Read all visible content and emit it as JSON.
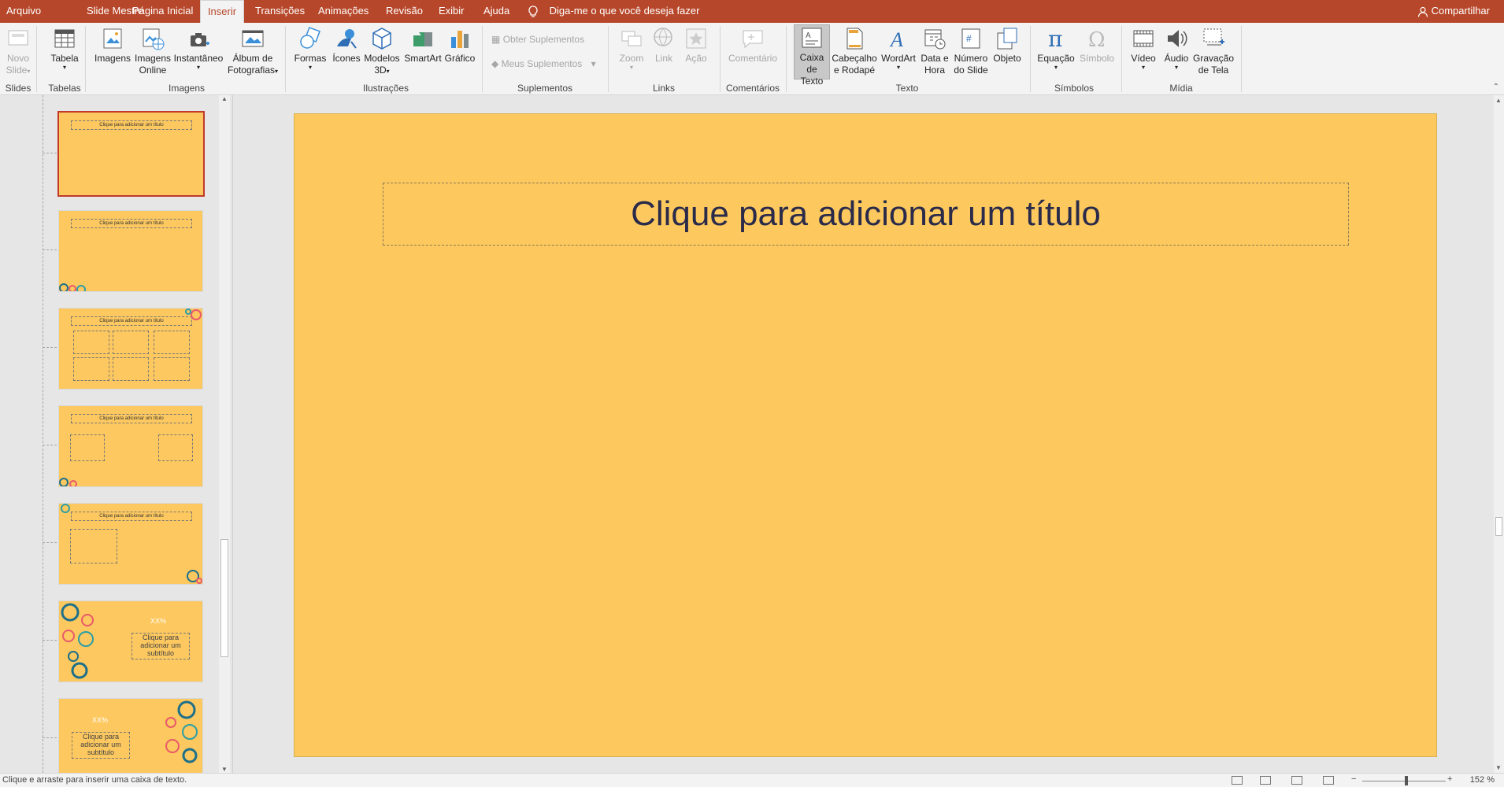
{
  "tabs": [
    "Arquivo",
    "Slide Mestre",
    "Página Inicial",
    "Inserir",
    "Transições",
    "Animações",
    "Revisão",
    "Exibir",
    "Ajuda"
  ],
  "tell_me": "Diga-me o que você deseja fazer",
  "share": "Compartilhar",
  "ribbon": {
    "novo_slide": [
      "Novo",
      "Slide"
    ],
    "tabela": "Tabela",
    "imagens": "Imagens",
    "imagens_online": [
      "Imagens",
      "Online"
    ],
    "instantaneo": "Instantâneo",
    "album": [
      "Álbum de",
      "Fotografias"
    ],
    "formas": "Formas",
    "icones": "Ícones",
    "modelos3d": [
      "Modelos",
      "3D"
    ],
    "smartart": "SmartArt",
    "grafico": "Gráfico",
    "obter_suplementos": "Obter Suplementos",
    "meus_suplementos": "Meus Suplementos",
    "zoom": "Zoom",
    "link": "Link",
    "acao": "Ação",
    "comentario": "Comentário",
    "caixa_texto": [
      "Caixa",
      "de Texto"
    ],
    "cabecalho": [
      "Cabeçalho",
      "e Rodapé"
    ],
    "wordart": "WordArt",
    "data_hora": [
      "Data e",
      "Hora"
    ],
    "numero_slide": [
      "Número",
      "do Slide"
    ],
    "objeto": "Objeto",
    "equacao": "Equação",
    "simbolo": "Símbolo",
    "video": "Vídeo",
    "audio": "Áudio",
    "gravacao": [
      "Gravação",
      "de Tela"
    ],
    "groups": {
      "slides": "Slides",
      "tabelas": "Tabelas",
      "imagens": "Imagens",
      "ilustracoes": "Ilustrações",
      "suplementos": "Suplementos",
      "links": "Links",
      "comentarios": "Comentários",
      "texto": "Texto",
      "simbolos": "Símbolos",
      "midia": "Mídia"
    }
  },
  "thumbs": {
    "title": "Clique para adicionar um título",
    "subtitle": "Clique para adicionar um subtítulo",
    "pct": "XX%"
  },
  "slide": {
    "title_placeholder": "Clique para adicionar um título"
  },
  "status": {
    "message": "Clique e arraste para inserir uma caixa de texto.",
    "zoom": "152 %"
  },
  "colors": {
    "accent": "#b7472a",
    "slide_bg": "#fdc95e",
    "title_text": "#2a2a4a"
  }
}
